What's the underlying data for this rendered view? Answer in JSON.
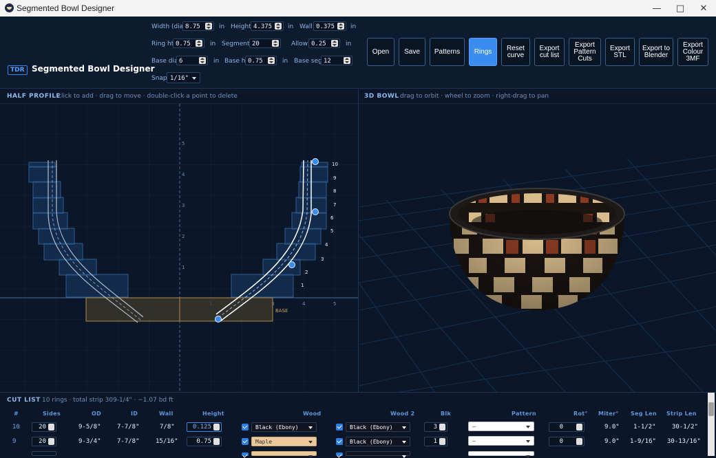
{
  "window": {
    "title": "Segmented Bowl Designer"
  },
  "brand": {
    "badge": "TDR",
    "title": "Segmented Bowl Designer"
  },
  "params": {
    "width": {
      "label": "Width (dia)",
      "value": "8.75",
      "unit": "in"
    },
    "height": {
      "label": "Height",
      "value": "4.375",
      "unit": "in"
    },
    "wall": {
      "label": "Wall",
      "value": "0.375",
      "unit": "in"
    },
    "ring_ht": {
      "label": "Ring ht",
      "value": "0.75",
      "unit": "in"
    },
    "segments": {
      "label": "Segments",
      "value": "20"
    },
    "allow": {
      "label": "Allow",
      "value": "0.25",
      "unit": "in"
    },
    "base_dia": {
      "label": "Base dia",
      "value": "6",
      "unit": "in"
    },
    "base_ht": {
      "label": "Base ht",
      "value": "0.75",
      "unit": "in"
    },
    "base_segs": {
      "label": "Base segs",
      "value": "12"
    },
    "snap": {
      "label": "Snap",
      "value": "1/16\""
    }
  },
  "toolbar": {
    "open": "Open",
    "save": "Save",
    "patterns": "Patterns",
    "rings": "Rings",
    "reset_curve": "Reset curve",
    "export_cut_list": "Export cut list",
    "export_pattern_cuts": "Export Pattern Cuts",
    "export_stl": "Export STL",
    "export_blender": "Export to Blender",
    "export_3mf": "Export Colour 3MF"
  },
  "half_profile": {
    "title": "HALF PROFILE",
    "hint": "click to add · drag to move · double-click a point to delete",
    "y_ticks": [
      "1",
      "2",
      "3",
      "4",
      "5"
    ],
    "x_ticks": [
      "1",
      "2",
      "3",
      "4",
      "5"
    ],
    "ring_labels": [
      "1",
      "2",
      "3",
      "4",
      "5",
      "6",
      "7",
      "8",
      "9",
      "10"
    ],
    "base_label": "BASE"
  },
  "bowl_3d": {
    "title": "3D BOWL",
    "hint": "drag to orbit · wheel to zoom · right-drag to pan",
    "colors": {
      "ebony": "#1b1512",
      "maple": "#d8bc8c",
      "padauk": "#8a3a22"
    }
  },
  "cut_list": {
    "title": "CUT LIST",
    "summary": "10 rings · total strip 309-1/4\" · ~1.07 bd ft",
    "headers": [
      "#",
      "Sides",
      "OD",
      "ID",
      "Wall",
      "Height",
      "Wood",
      "Wood 2",
      "Blk",
      "Pattern",
      "Rot°",
      "Miter°",
      "Seg Len",
      "Strip Len"
    ],
    "rows": [
      {
        "num": "10",
        "sides": "20",
        "od": "9-5/8\"",
        "id": "7-7/8\"",
        "wall": "7/8\"",
        "height": "0.125",
        "wood": "Black (Ebony)",
        "wood2": "Black (Ebony)",
        "blk": "3",
        "pattern": "–",
        "rot": "0",
        "miter": "9.0°",
        "seg_len": "1-1/2\"",
        "strip_len": "30-1/2\""
      },
      {
        "num": "9",
        "sides": "20",
        "od": "9-3/4\"",
        "id": "7-7/8\"",
        "wall": "15/16\"",
        "height": "0.75",
        "wood": "Maple",
        "wood2": "Black (Ebony)",
        "blk": "1",
        "pattern": "–",
        "rot": "0",
        "miter": "9.0°",
        "seg_len": "1-9/16\"",
        "strip_len": "30-13/16\""
      }
    ]
  }
}
